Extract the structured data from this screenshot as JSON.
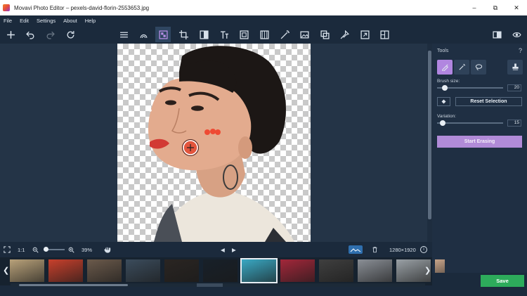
{
  "window": {
    "title": "Movavi Photo Editor – pexels-david-florin-2553653.jpg",
    "minimize": "–",
    "maximize": "⧉",
    "close": "✕"
  },
  "menu": [
    "File",
    "Edit",
    "Settings",
    "About",
    "Help"
  ],
  "panel": {
    "title": "Tools",
    "help": "?",
    "brush_size_label": "Brush size:",
    "brush_size_value": "20",
    "brush_size_level": 0.12,
    "reset_selection": "Reset Selection",
    "variation_label": "Variation:",
    "variation_value": "15",
    "variation_level": 0.08,
    "start_erasing": "Start Erasing",
    "save": "Save"
  },
  "bottom": {
    "ratio": "1:1",
    "zoom": "39%",
    "zoom_level": 0.1,
    "dimensions": "1280×1920",
    "info": "i"
  },
  "colors": {
    "accent": "#b186e0",
    "save": "#2dab5b",
    "background": "#1b2a3c"
  },
  "thumbnails": [
    {
      "id": "t0",
      "color": "#b9a27a"
    },
    {
      "id": "t1",
      "color": "#c8402c"
    },
    {
      "id": "t2",
      "color": "#6b5a4b"
    },
    {
      "id": "t3",
      "color": "#3b4c5c"
    },
    {
      "id": "t4",
      "color": "#2a2522"
    },
    {
      "id": "t5",
      "color": "#182029"
    },
    {
      "id": "t6",
      "color": "#3aa9c4"
    },
    {
      "id": "t7",
      "color": "#a3273a"
    },
    {
      "id": "t8",
      "color": "#3f3f3f"
    },
    {
      "id": "t9",
      "color": "#8a8f96"
    },
    {
      "id": "t10",
      "color": "#9aa1a6"
    },
    {
      "id": "t11",
      "color": "#c7a48a"
    }
  ]
}
